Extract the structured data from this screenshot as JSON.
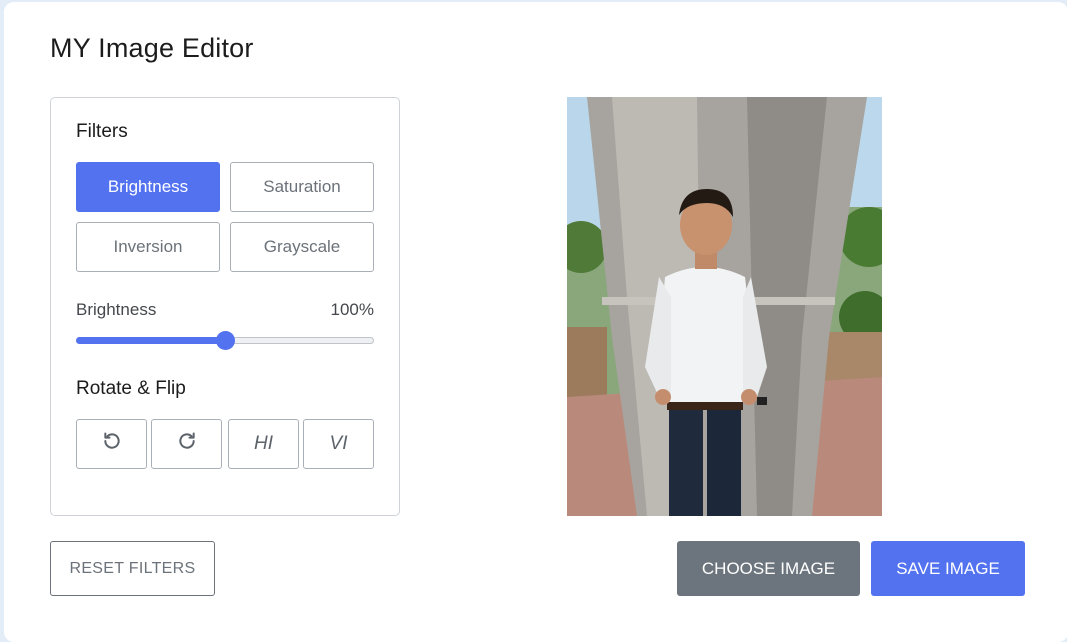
{
  "app": {
    "title": "MY Image Editor"
  },
  "filters": {
    "heading": "Filters",
    "options": [
      {
        "label": "Brightness",
        "active": true
      },
      {
        "label": "Saturation",
        "active": false
      },
      {
        "label": "Inversion",
        "active": false
      },
      {
        "label": "Grayscale",
        "active": false
      }
    ],
    "slider": {
      "name": "Brightness",
      "value_text": "100%",
      "value_fraction": 0.5
    }
  },
  "rotate_flip": {
    "heading": "Rotate & Flip",
    "rotate_left_icon": "rotate-left-icon",
    "rotate_right_icon": "rotate-right-icon",
    "flip_horizontal_label": "HI",
    "flip_vertical_label": "VI"
  },
  "actions": {
    "reset_label": "RESET FILTERS",
    "choose_label": "CHOOSE IMAGE",
    "save_label": "SAVE IMAGE"
  },
  "colors": {
    "accent": "#5372f0",
    "secondary": "#6c757d"
  }
}
